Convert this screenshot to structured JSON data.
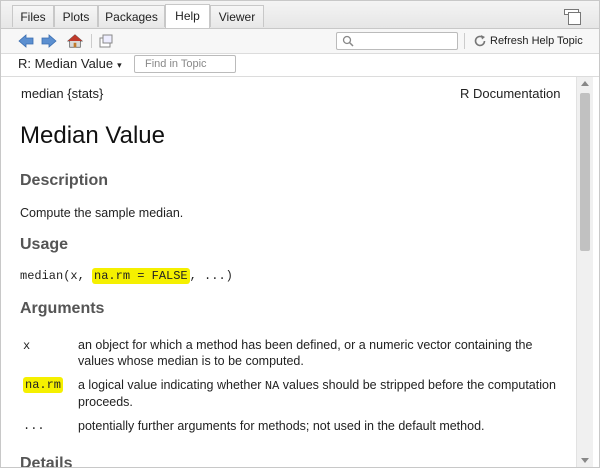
{
  "tabs": [
    {
      "label": "Files"
    },
    {
      "label": "Plots"
    },
    {
      "label": "Packages"
    },
    {
      "label": "Help"
    },
    {
      "label": "Viewer"
    }
  ],
  "toolbar": {
    "refresh_label": "Refresh Help Topic",
    "search_placeholder": ""
  },
  "topic": {
    "title": "R: Median Value",
    "caret": "▾",
    "find_placeholder": "Find in Topic"
  },
  "doc": {
    "package": "median {stats}",
    "rdoc": "R Documentation",
    "title": "Median Value",
    "description_heading": "Description",
    "description_text": "Compute the sample median.",
    "usage_heading": "Usage",
    "usage_prefix": "median(x, ",
    "usage_highlight": "na.rm = FALSE",
    "usage_suffix": ", ...)",
    "arguments_heading": "Arguments",
    "arguments": [
      {
        "name": "x",
        "desc": "an object for which a method has been defined, or a numeric vector containing the values whose median is to be computed."
      },
      {
        "name": "na.rm",
        "desc_pre": "a logical value indicating whether ",
        "desc_code": "NA",
        "desc_post": " values should be stripped before the computation proceeds."
      },
      {
        "name": "...",
        "desc": "potentially further arguments for methods; not used in the default method."
      }
    ],
    "details_heading": "Details"
  },
  "colors": {
    "highlight": "#f5f000",
    "heading": "#555555",
    "home_icon": "#c0392b",
    "nav_arrow": "#5b8fd0"
  }
}
